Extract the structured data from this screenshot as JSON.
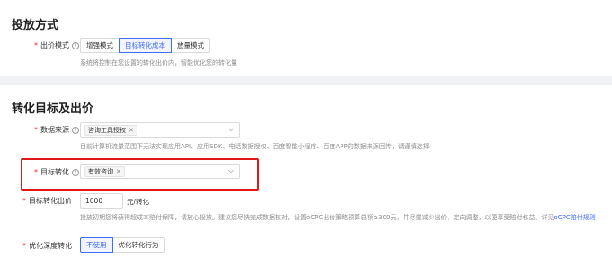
{
  "section1": {
    "title": "投放方式",
    "bid_mode": {
      "label": "出价模式",
      "options": [
        "增强模式",
        "目标转化成本",
        "放量模式"
      ],
      "selected": "目标转化成本",
      "hint": "系统将控制在您设置的转化出价内，智能优化您的转化量"
    }
  },
  "section2": {
    "title": "转化目标及出价",
    "data_source": {
      "label": "数据来源",
      "tags": [
        "咨询工具授权"
      ],
      "hint": "目前计算机流量范围下无法实现应用API、应用SDK、电话数据授权、百度智能小程序、百度APP的数据来源回传，请谨慎选择"
    },
    "target_conversion": {
      "label": "目标转化",
      "tags": [
        "有效咨询"
      ]
    },
    "target_bid": {
      "label": "目标转化出价",
      "value": "1000",
      "unit": "元/转化",
      "hint": "投放初期您将获得超成本赔付保障，请放心投放。建议您尽快完成数据核对，设置oCPC出价策略预算总额≥300元，并尽量减少出价、定向调整，以便享受赔付权益。详见",
      "hint_link": "oCPC赔付规则"
    },
    "deep_conversion": {
      "label": "优化深度转化",
      "options": [
        "不使用",
        "优化转化行为"
      ],
      "selected": "不使用"
    }
  },
  "colors": {
    "accent": "#3f6bff",
    "required": "#f5222d",
    "highlight_box": "#e01818"
  }
}
